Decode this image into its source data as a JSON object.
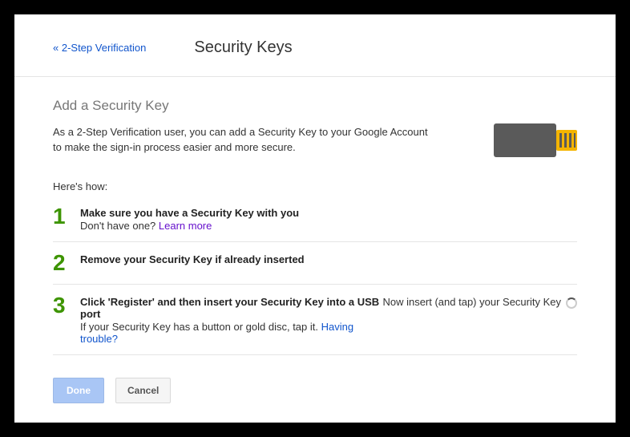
{
  "header": {
    "back_link": "« 2-Step Verification",
    "page_title": "Security Keys"
  },
  "section_title": "Add a Security Key",
  "intro": "As a 2-Step Verification user, you can add a Security Key to your Google Account to make the sign-in process easier and more secure.",
  "heres_how": "Here's how:",
  "steps": [
    {
      "num": "1",
      "title": "Make sure you have a Security Key with you",
      "sub_prefix": "Don't have one? ",
      "link": "Learn more"
    },
    {
      "num": "2",
      "title": "Remove your Security Key if already inserted"
    },
    {
      "num": "3",
      "title": "Click 'Register' and then insert your Security Key into a USB port",
      "sub_prefix": "If your Security Key has a button or gold disc, tap it. ",
      "link": "Having trouble?",
      "right_text": "Now insert (and tap) your Security Key"
    }
  ],
  "buttons": {
    "done": "Done",
    "cancel": "Cancel"
  }
}
